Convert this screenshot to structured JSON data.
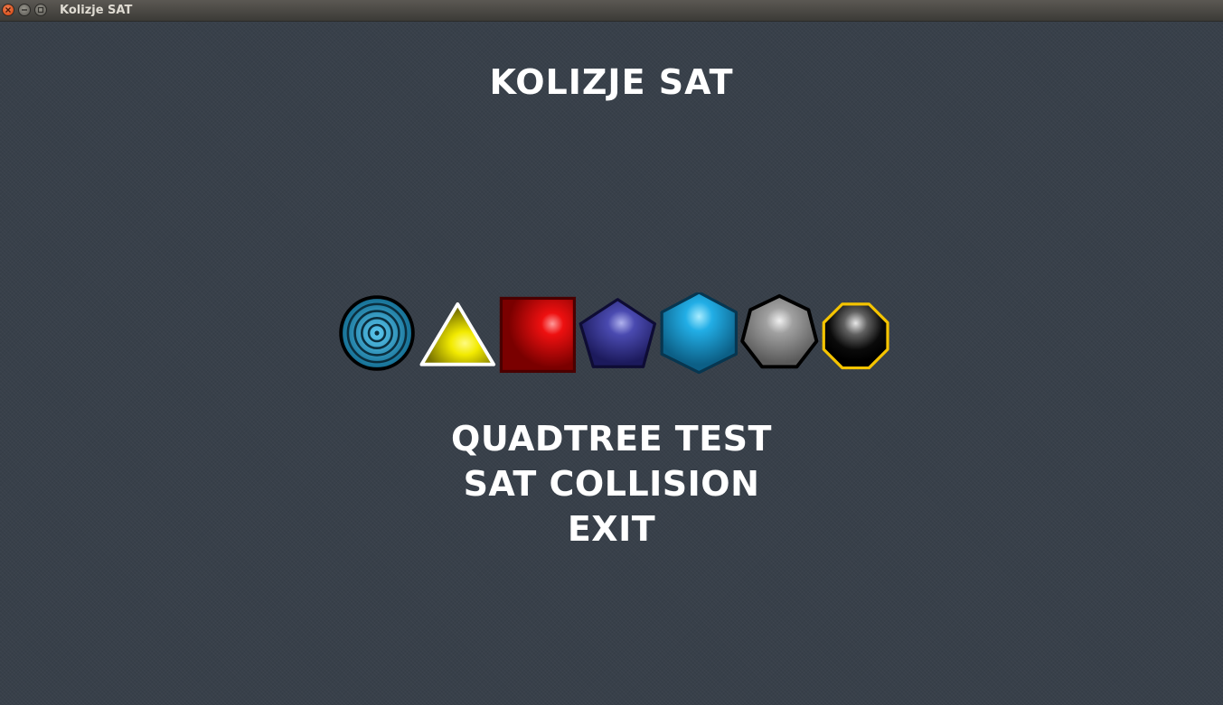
{
  "window": {
    "title": "Kolizje SAT"
  },
  "game": {
    "title": "KOLIZJE SAT"
  },
  "shapes": [
    {
      "name": "circle",
      "fill": "#1a86b0",
      "stroke": "#000000"
    },
    {
      "name": "triangle",
      "fill": "#c8c000",
      "stroke": "#ffffff"
    },
    {
      "name": "square",
      "fill": "#b00000",
      "stroke": "#5a0000"
    },
    {
      "name": "pentagon",
      "fill": "#2b2a78",
      "stroke": "#121040"
    },
    {
      "name": "hexagon",
      "fill": "#1592c8",
      "stroke": "#0a3e58"
    },
    {
      "name": "heptagon",
      "fill": "#8c8c8c",
      "stroke": "#000000"
    },
    {
      "name": "octagon",
      "fill": "#000000",
      "stroke": "#f5c400"
    }
  ],
  "menu": {
    "items": [
      "QUADTREE TEST",
      "SAT COLLISION",
      "EXIT"
    ]
  },
  "colors": {
    "background": "#38404a",
    "text": "#ffffff"
  }
}
